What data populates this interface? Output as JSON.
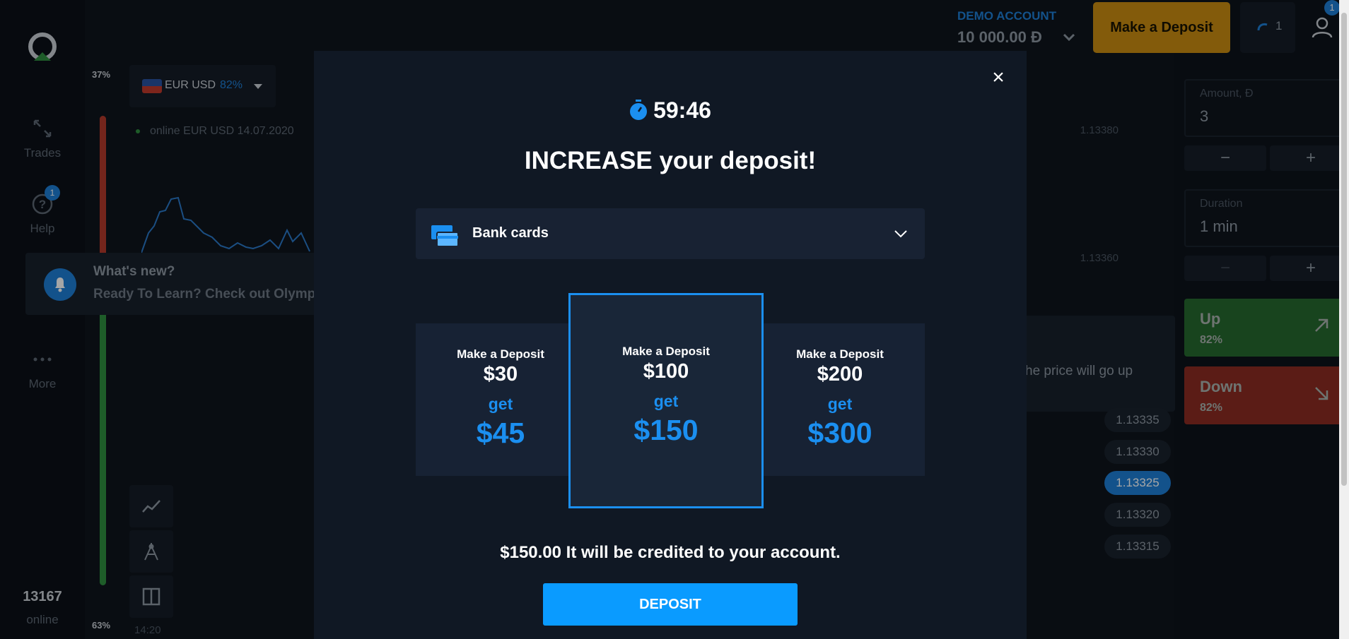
{
  "sidebar": {
    "trades_label": "Trades",
    "help_label": "Help",
    "help_badge": "1",
    "more_label": "More",
    "online_count": "13167",
    "online_label": "online"
  },
  "chart": {
    "sentiment_top": "37%",
    "sentiment_bottom": "63%",
    "pair_name": "EUR USD",
    "pair_pct": "82%",
    "status_text": "online EUR USD  14.07.2020",
    "price_levels": [
      "1.13380",
      "1.13360"
    ],
    "price_chips": [
      "1.13335",
      "1.13330",
      "1.13325",
      "1.13320",
      "1.13315"
    ],
    "active_chip": "1.13325",
    "time_label": "14:20",
    "hint_text": "he price will go up"
  },
  "news": {
    "title": "What's new?",
    "text": "Ready To Learn? Check out Olymp"
  },
  "topbar": {
    "account_type": "DEMO ACCOUNT",
    "balance": "10 000.00 Đ",
    "deposit_label": "Make a Deposit",
    "signals_count": "1",
    "profile_badge": "1"
  },
  "trade_panel": {
    "amount_label": "Amount, Đ",
    "amount_value": "3",
    "duration_label": "Duration",
    "duration_value": "1 min",
    "minus": "−",
    "plus": "+",
    "up_label": "Up",
    "up_pct": "82%",
    "down_label": "Down",
    "down_pct": "82%"
  },
  "modal": {
    "close": "×",
    "timer": "59:46",
    "title": "INCREASE your deposit!",
    "method": "Bank cards",
    "offers": [
      {
        "pre": "Make a Deposit",
        "amount": "$30",
        "get": "get",
        "bonus": "$45"
      },
      {
        "pre": "Make a Deposit",
        "amount": "$100",
        "get": "get",
        "bonus": "$150"
      },
      {
        "pre": "Make a Deposit",
        "amount": "$200",
        "get": "get",
        "bonus": "$300"
      }
    ],
    "credit_note": "$150.00 It will be credited to your account.",
    "deposit_button": "DEPOSIT"
  },
  "colors": {
    "accent": "#1b8ff0",
    "deposit_button": "#0a9bff",
    "deposit_top": "#c98d12",
    "up": "#26692f",
    "down": "#8c2c22"
  }
}
